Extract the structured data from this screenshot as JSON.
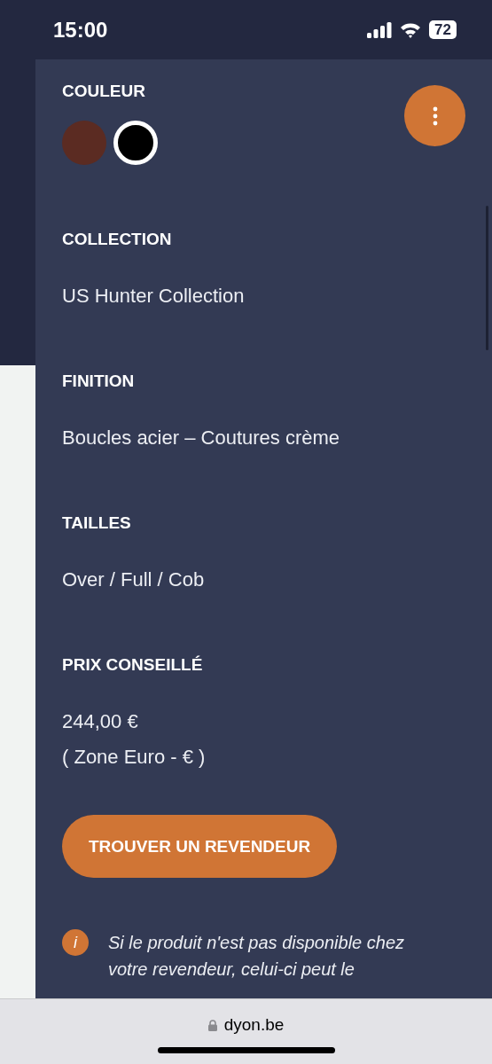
{
  "status_bar": {
    "time": "15:00",
    "battery": "72"
  },
  "sections": [
    {
      "kind": "swatches",
      "title": "COULEUR",
      "swatches": [
        {
          "color": "#5b2b22",
          "selected": false
        },
        {
          "color": "#000000",
          "selected": true
        }
      ]
    },
    {
      "kind": "text",
      "title": "COLLECTION",
      "lines": [
        "US Hunter Collection"
      ]
    },
    {
      "kind": "text",
      "title": "FINITION",
      "lines": [
        "Boucles acier – Coutures crème"
      ]
    },
    {
      "kind": "text",
      "title": "TAILLES",
      "lines": [
        "Over / Full / Cob"
      ]
    },
    {
      "kind": "text",
      "title": "PRIX CONSEILLÉ",
      "lines": [
        "244,00 €",
        "( Zone Euro - € )"
      ]
    }
  ],
  "dealer_button": "TROUVER UN REVENDEUR",
  "info": {
    "icon": "i",
    "text": "Si le produit n'est pas disponible chez votre revendeur, celui-ci peut le"
  },
  "browser_bar": {
    "url": "dyon.be"
  }
}
